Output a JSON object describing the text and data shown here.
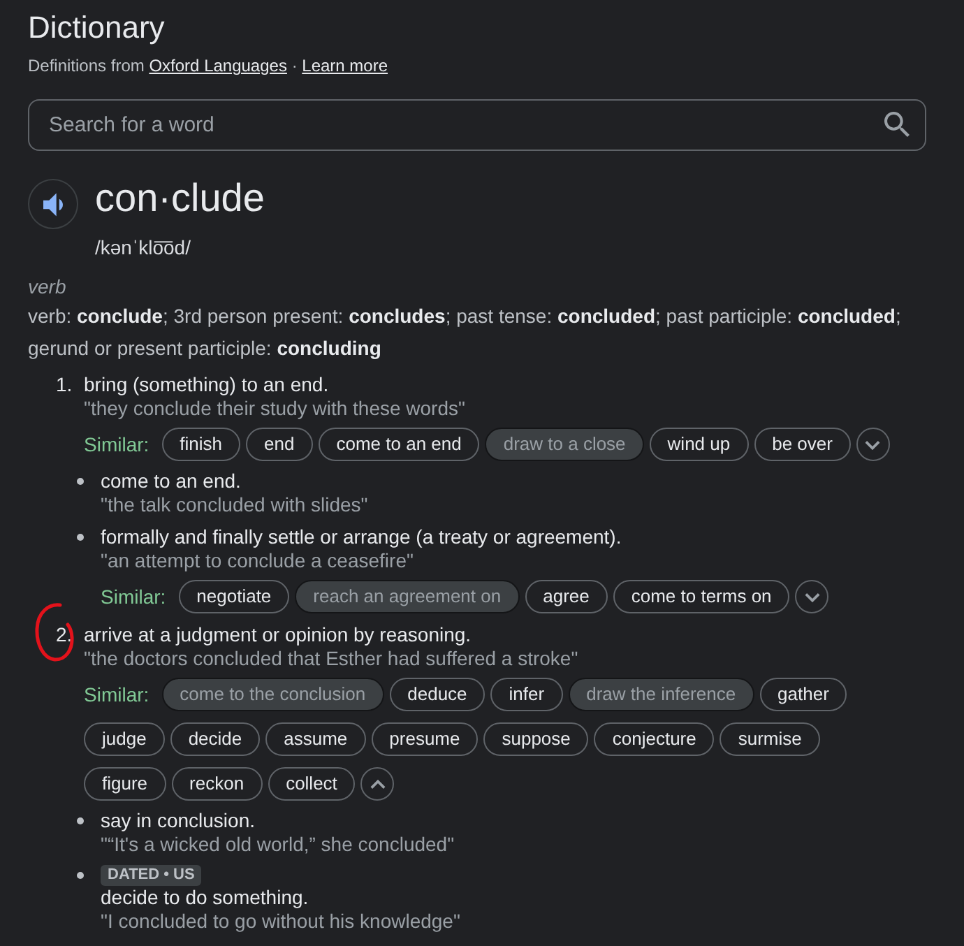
{
  "header": {
    "title": "Dictionary",
    "source": {
      "prefix": "Definitions from",
      "link": "Oxford Languages",
      "separator": "·",
      "learn_more": "Learn more"
    }
  },
  "search": {
    "placeholder": "Search for a word"
  },
  "entry": {
    "word": "con·clude",
    "pronunciation": "/kənˈklo͞od/",
    "part_of_speech": "verb",
    "forms": "verb: **conclude**; 3rd person present: **concludes**; past tense: **concluded**; past participle: **concluded**; gerund or present participle: **concluding**"
  },
  "senses": [
    {
      "number": "1.",
      "circled": false,
      "definition": "bring (something) to an end.",
      "example": "\"they conclude their study with these words\"",
      "similar": {
        "label": "Similar:",
        "expanded": false,
        "words": [
          {
            "text": "finish",
            "disabled": false
          },
          {
            "text": "end",
            "disabled": false
          },
          {
            "text": "come to an end",
            "disabled": false
          },
          {
            "text": "draw to a close",
            "disabled": true
          },
          {
            "text": "wind up",
            "disabled": false
          },
          {
            "text": "be over",
            "disabled": false
          }
        ]
      },
      "subsenses": [
        {
          "definition": "come to an end.",
          "example": "\"the talk concluded with slides\""
        },
        {
          "definition": "formally and finally settle or arrange (a treaty or agreement).",
          "example": "\"an attempt to conclude a ceasefire\"",
          "similar": {
            "label": "Similar:",
            "expanded": false,
            "words": [
              {
                "text": "negotiate",
                "disabled": false
              },
              {
                "text": "reach an agreement on",
                "disabled": true
              },
              {
                "text": "agree",
                "disabled": false
              },
              {
                "text": "come to terms on",
                "disabled": false
              }
            ]
          }
        }
      ]
    },
    {
      "number": "2.",
      "circled": true,
      "definition": "arrive at a judgment or opinion by reasoning.",
      "example": "\"the doctors concluded that Esther had suffered a stroke\"",
      "similar": {
        "label": "Similar:",
        "expanded": true,
        "words": [
          {
            "text": "come to the conclusion",
            "disabled": true
          },
          {
            "text": "deduce",
            "disabled": false
          },
          {
            "text": "infer",
            "disabled": false
          },
          {
            "text": "draw the inference",
            "disabled": true
          },
          {
            "text": "gather",
            "disabled": false
          },
          {
            "text": "judge",
            "disabled": false
          },
          {
            "text": "decide",
            "disabled": false
          },
          {
            "text": "assume",
            "disabled": false
          },
          {
            "text": "presume",
            "disabled": false
          },
          {
            "text": "suppose",
            "disabled": false
          },
          {
            "text": "conjecture",
            "disabled": false
          },
          {
            "text": "surmise",
            "disabled": false
          },
          {
            "text": "figure",
            "disabled": false
          },
          {
            "text": "reckon",
            "disabled": false
          },
          {
            "text": "collect",
            "disabled": false
          }
        ]
      },
      "subsenses": [
        {
          "definition": "say in conclusion.",
          "example": "\"“It's a wicked old world,” she concluded\""
        },
        {
          "tags": [
            "DATED • US"
          ],
          "definition": "decide to do something.",
          "example": "\"I concluded to go without his knowledge\""
        }
      ]
    }
  ]
}
